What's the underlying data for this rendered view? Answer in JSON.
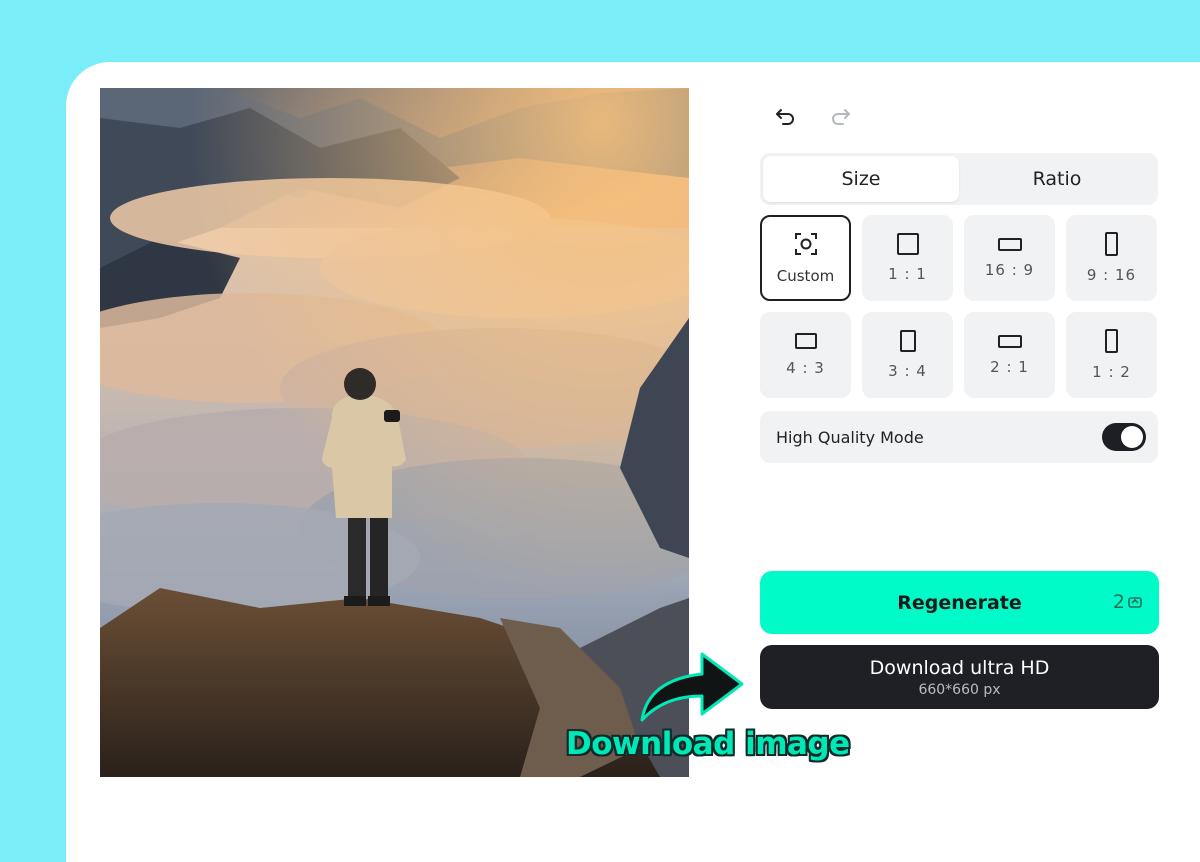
{
  "history": {
    "undo_icon": "undo-icon",
    "redo_icon": "redo-icon"
  },
  "tabs": [
    {
      "label": "Size",
      "active": true
    },
    {
      "label": "Ratio",
      "active": false
    }
  ],
  "size_options": [
    {
      "label": "Custom",
      "icon": "custom-scan-icon",
      "active": true
    },
    {
      "label": "1 : 1",
      "icon": "square-icon"
    },
    {
      "label": "16 : 9",
      "icon": "landscape-wide-icon"
    },
    {
      "label": "9 : 16",
      "icon": "portrait-tall-icon"
    },
    {
      "label": "4 : 3",
      "icon": "landscape-icon"
    },
    {
      "label": "3 : 4",
      "icon": "portrait-icon"
    },
    {
      "label": "2 : 1",
      "icon": "landscape-2-1-icon"
    },
    {
      "label": "1 : 2",
      "icon": "portrait-1-2-icon"
    }
  ],
  "high_quality": {
    "label": "High Quality Mode",
    "enabled": true
  },
  "regenerate": {
    "label": "Regenerate",
    "credits": "2"
  },
  "download": {
    "label": "Download ultra HD",
    "size": "660*660 px"
  },
  "callout": {
    "text": "Download image"
  },
  "colors": {
    "background": "#7aeef8",
    "accent": "#00fbc8",
    "dark_button": "#1e2026",
    "callout_text": "#00e8b6"
  }
}
